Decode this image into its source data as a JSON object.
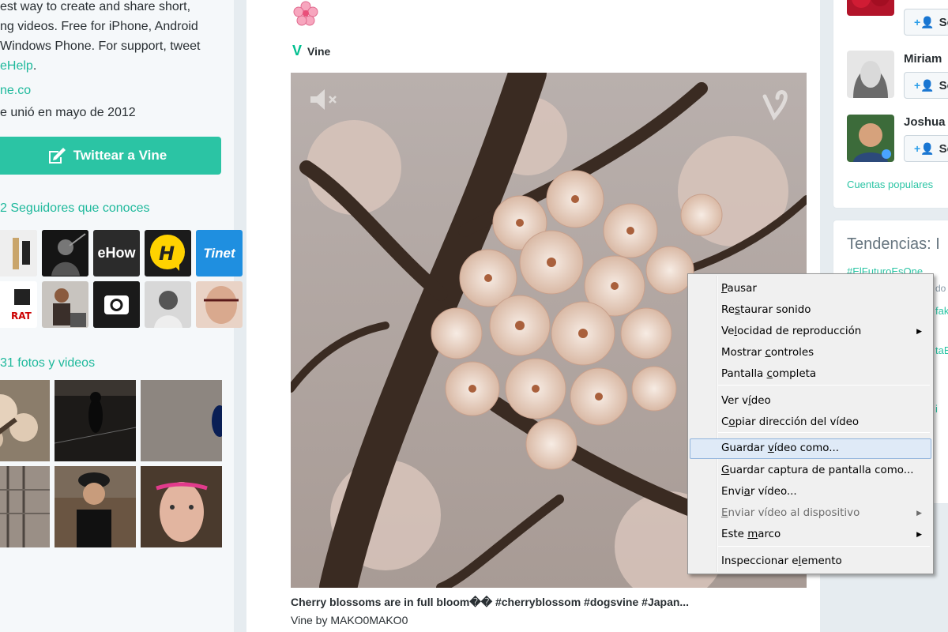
{
  "left": {
    "bio_lines": [
      "est way to create and share short,",
      "ng videos. Free for iPhone, Android",
      "Windows Phone. For support, tweet"
    ],
    "bio_handle": "eHelp",
    "bio_period": ".",
    "site_link": "ne.co",
    "joined": "e unió en mayo de 2012",
    "tweet_to_button": "Twittear a Vine",
    "followers_title": "2 Seguidores que conoces",
    "media_title": "31 fotos y videos",
    "follower_tiles": [
      "ehow-logo",
      "yelp-style-logo",
      "tinet-logo"
    ],
    "ehow_label": "eHow",
    "tinet_label": "Tinet"
  },
  "tweet": {
    "source": "Vine",
    "caption": "Cherry blossoms are in full bloom�� #cherryblossom #dogsvine #Japan...",
    "byline": "Vine by MAKO0MAKO0"
  },
  "right": {
    "who_to_follow": [
      {
        "name": "Miriam"
      },
      {
        "name": "Joshua"
      }
    ],
    "follow_label": "Se",
    "popular_accounts": "Cuentas populares",
    "trends_title": "Tendencias: I",
    "trends": [
      "#ElFuturoEsOne",
      "do",
      "fak",
      "taB",
      "i"
    ]
  },
  "context_menu": {
    "items": [
      {
        "pre": "",
        "u": "P",
        "post": "ausar",
        "arrow": false,
        "disabled": false
      },
      {
        "pre": "Re",
        "u": "s",
        "post": "taurar sonido",
        "arrow": false,
        "disabled": false
      },
      {
        "pre": "Ve",
        "u": "l",
        "post": "ocidad de reproducción",
        "arrow": true,
        "disabled": false
      },
      {
        "pre": "Mostrar ",
        "u": "c",
        "post": "ontroles",
        "arrow": false,
        "disabled": false
      },
      {
        "pre": "Pantalla ",
        "u": "c",
        "post": "ompleta",
        "arrow": false,
        "disabled": false
      },
      {
        "pre": "Ver v",
        "u": "í",
        "post": "deo",
        "arrow": false,
        "disabled": false
      },
      {
        "pre": "C",
        "u": "o",
        "post": "piar dirección del vídeo",
        "arrow": false,
        "disabled": false
      },
      {
        "pre": "Guardar ",
        "u": "v",
        "post": "ídeo como...",
        "arrow": false,
        "disabled": false,
        "highlighted": true
      },
      {
        "pre": "",
        "u": "G",
        "post": "uardar captura de pantalla como...",
        "arrow": false,
        "disabled": false
      },
      {
        "pre": "Envi",
        "u": "a",
        "post": "r vídeo...",
        "arrow": false,
        "disabled": false
      },
      {
        "pre": "",
        "u": "E",
        "post": "nviar vídeo al dispositivo",
        "arrow": true,
        "disabled": true
      },
      {
        "pre": "Este ",
        "u": "m",
        "post": "arco",
        "arrow": true,
        "disabled": false
      },
      {
        "pre": "Inspeccionar e",
        "u": "l",
        "post": "emento",
        "arrow": false,
        "disabled": false
      }
    ]
  },
  "colors": {
    "accent": "#2bc4a4",
    "vine_green": "#00bf8f",
    "menu_bg": "#f0f0f0",
    "menu_highlight": "#dfeaf7"
  }
}
